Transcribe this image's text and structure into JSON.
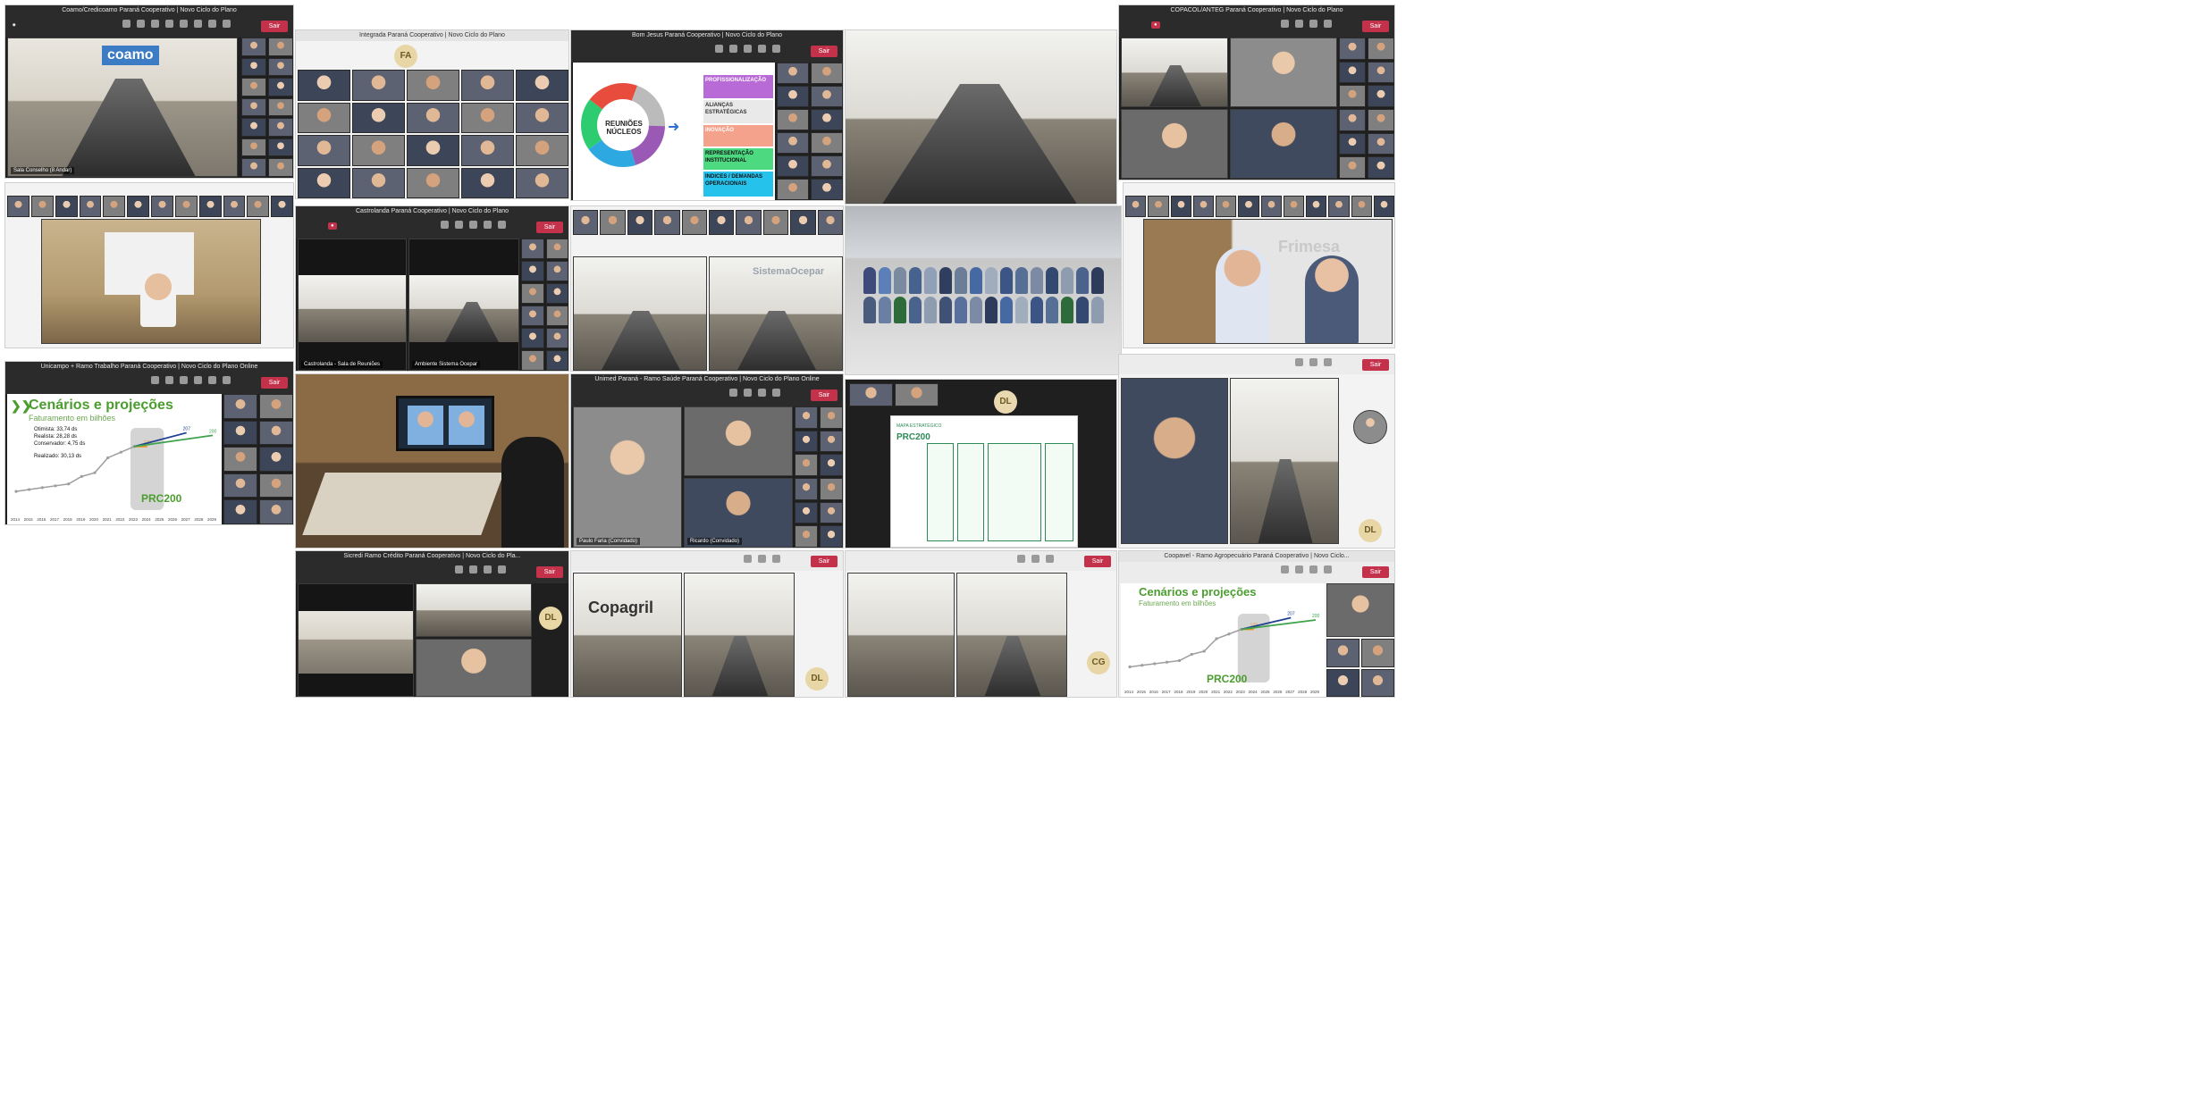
{
  "tiles": {
    "coamo": {
      "title": "Coamo/Credicoamo Paraná Cooperativo | Novo Ciclo do Plano",
      "leave": "Sair",
      "logo": "coamo",
      "name_tag": "Sala Conselho (8 Andar)"
    },
    "grid_top": {
      "title": "Integrada Paraná Cooperativo | Novo Ciclo do Plano",
      "avatar": "FA"
    },
    "bom_jesus": {
      "title": "Bom Jesus Paraná Cooperativo | Novo Ciclo do Plano",
      "leave": "Sair",
      "slide_center": "REUNIÕES NÚCLEOS",
      "slide_items": [
        "PROFISSIONALIZAÇÃO",
        "ALIANÇAS ESTRATÉGICAS",
        "INOVAÇÃO",
        "REPRESENTAÇÃO INSTITUCIONAL",
        "INDICES / DEMANDAS OPERACIONAIS"
      ]
    },
    "coopercolatte": {
      "title": "COPACOL/ANTEG Paraná Cooperativo | Novo Ciclo do Plano",
      "leave": "Sair"
    },
    "castrolanda": {
      "title": "Castrolanda Paraná Cooperativo | Novo Ciclo do Plano",
      "leave": "Sair",
      "name_left": "Castrolanda - Sala de Reuniões",
      "name_right": "Ambiente Sistema Ocepar"
    },
    "ocepar_room": {
      "brand": "SistemaOcepar"
    },
    "frimesa": {
      "brand": "Frimesa"
    },
    "unicampo": {
      "title": "Unicampo + Ramo Trabalho Paraná Cooperativo | Novo Ciclo do Plano Online",
      "leave": "Sair",
      "chart_title": "Cenários e projeções",
      "chart_sub": "Faturamento em bilhões",
      "legend": [
        "Otimista: 33,74 ds",
        "Realista: 28,28 ds",
        "Conservador: 4,75 ds",
        "Realizado: 30,13 ds"
      ],
      "brand": "PRC200"
    },
    "unimed": {
      "title": "Unimed Paraná - Ramo Saúde Paraná Cooperativo | Novo Ciclo do Plano Online",
      "leave": "Sair",
      "name_a": "Paulo Faria (Convidado)",
      "name_b": "Ricardo (Convidado)"
    },
    "mapa": {
      "brand": "PRC200",
      "heading": "MAPA ESTRATÉGICO"
    },
    "sicoob": {
      "title": "Sicredi Ramo Crédito Paraná Cooperativo | Novo Ciclo do Pla...",
      "leave": "Sair",
      "avatar": "DL"
    },
    "copagril": {
      "brand": "Copagril",
      "leave": "Sair",
      "avatar": "DL"
    },
    "lar": {
      "leave": "Sair",
      "avatar": "CG"
    },
    "agro": {
      "title": "Coopavel - Ramo Agropecuário Paraná Cooperativo | Novo Ciclo...",
      "leave": "Sair",
      "chart_title": "Cenários e projeções",
      "chart_sub": "Faturamento em bilhões",
      "brand": "PRC200"
    }
  },
  "chart_data": {
    "type": "line",
    "title": "Cenários e projeções",
    "subtitle": "Faturamento em bilhões",
    "x": [
      "2014",
      "2015",
      "2016",
      "2017",
      "2018",
      "2019",
      "2020",
      "2021",
      "2022",
      "2023",
      "2024",
      "2025",
      "2026",
      "2027",
      "2028",
      "2029"
    ],
    "series": [
      {
        "name": "Otimista",
        "color": "#f0961e",
        "values": [
          null,
          null,
          null,
          null,
          null,
          null,
          null,
          null,
          null,
          null,
          170,
          null,
          null,
          null,
          null,
          null
        ]
      },
      {
        "name": "Realista",
        "color": "#1f3f8f",
        "values": [
          null,
          null,
          null,
          null,
          null,
          null,
          null,
          null,
          null,
          null,
          null,
          null,
          null,
          207,
          null,
          null
        ]
      },
      {
        "name": "Conservador",
        "color": "#3fa34d",
        "values": [
          null,
          null,
          null,
          null,
          null,
          null,
          null,
          null,
          null,
          null,
          null,
          null,
          null,
          null,
          null,
          200
        ]
      },
      {
        "name": "Realizado",
        "color": "#9e9e9e",
        "values": [
          50,
          55,
          60,
          65,
          70,
          90,
          100,
          140,
          155,
          170,
          null,
          null,
          null,
          null,
          null,
          null
        ]
      }
    ],
    "colors": {
      "accent": "#4a9d2e",
      "leave": "#c4314b"
    }
  }
}
